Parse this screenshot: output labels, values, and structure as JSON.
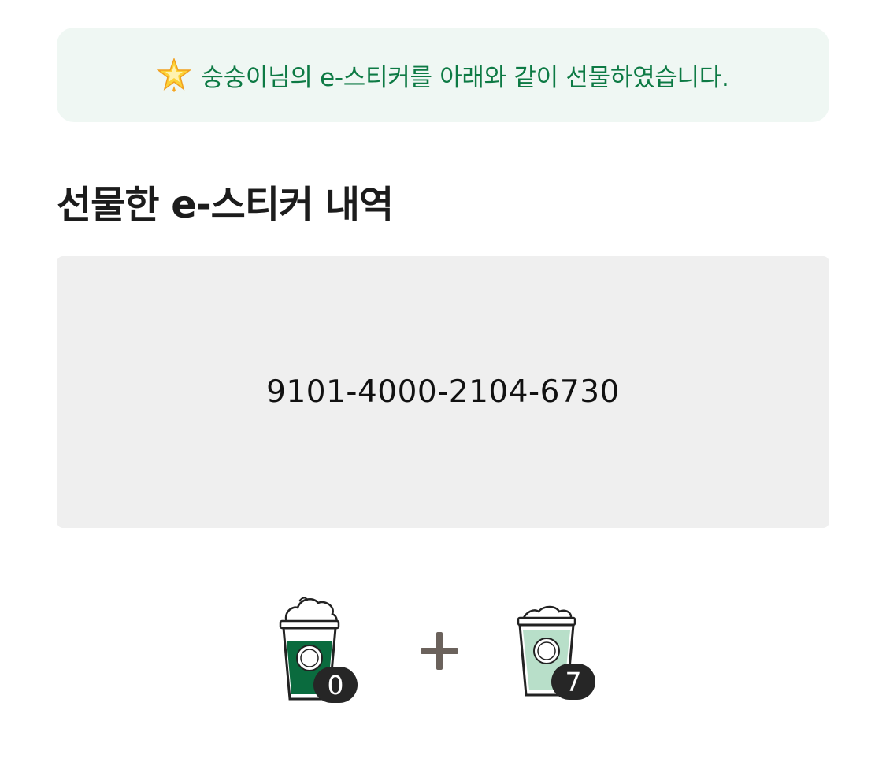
{
  "notice": {
    "icon": "glowing-star-icon",
    "message": "숭숭이님의 e-스티커를 아래와 같이 선물하였습니다.",
    "text_color": "#0d7a44",
    "background_color": "#eff7f3"
  },
  "section": {
    "title": "선물한 e-스티커 내역"
  },
  "gift": {
    "code": "9101-4000-2104-6730"
  },
  "stickers": {
    "items": [
      {
        "icon": "whipped-frappuccino-cup-icon",
        "color": "#0a6b3e",
        "count": "0"
      },
      {
        "icon": "iced-drink-cup-icon",
        "color": "#b8dfc9",
        "count": "7"
      }
    ],
    "operator_icon": "plus-icon"
  }
}
